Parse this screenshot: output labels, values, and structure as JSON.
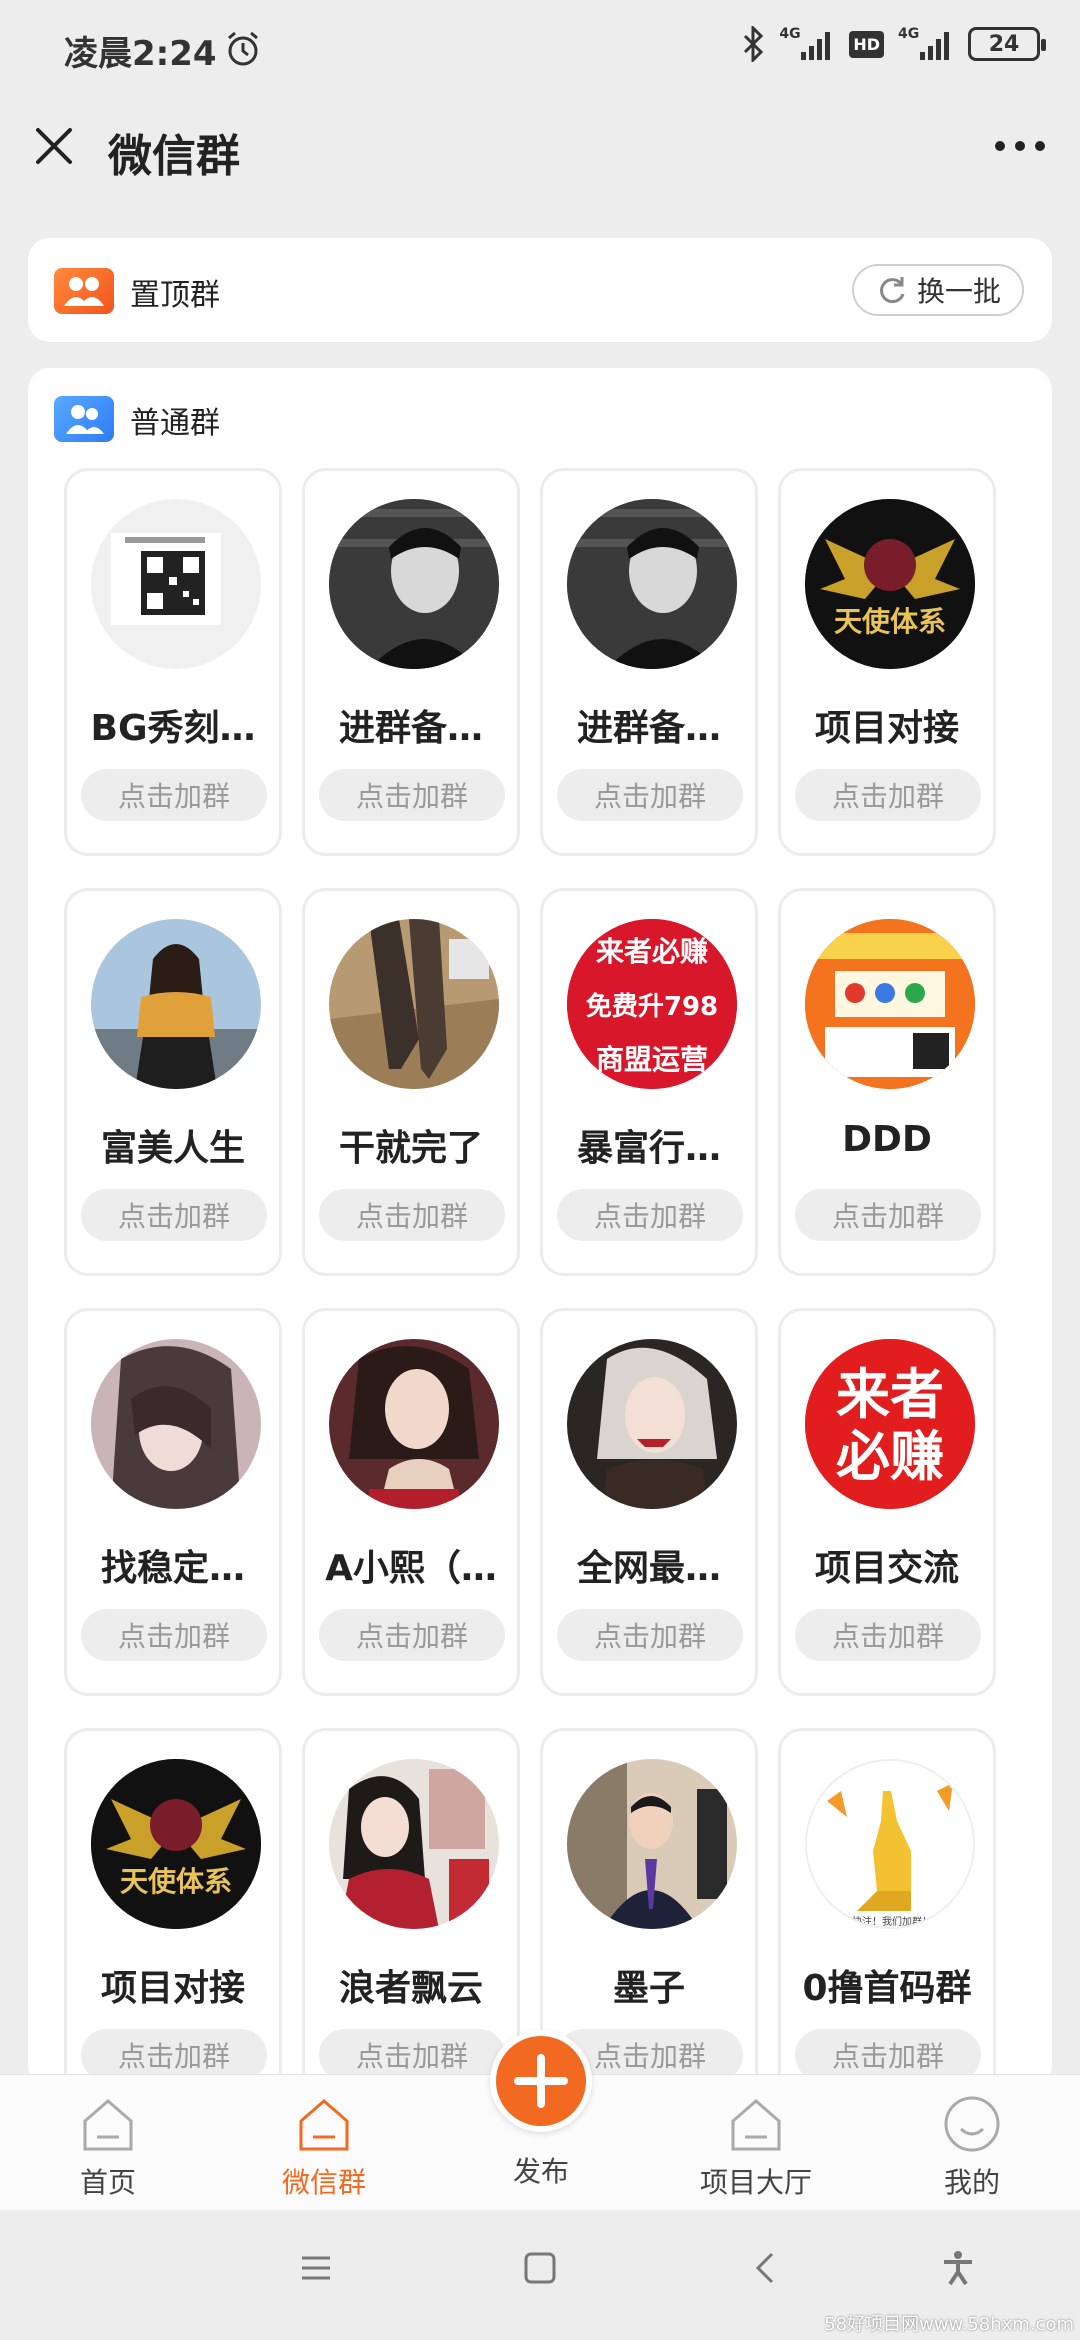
{
  "status_bar": {
    "time": "凌晨2:24",
    "battery": "24",
    "network_a": "4G",
    "network_b": "4G",
    "hd": "HD"
  },
  "header": {
    "title": "微信群"
  },
  "pinned": {
    "label": "置顶群",
    "refresh_label": "换一批"
  },
  "normal": {
    "label": "普通群"
  },
  "groups": [
    {
      "name": "BG秀刻…",
      "button": "点击加群",
      "avatar": "qr-code"
    },
    {
      "name": "进群备…",
      "button": "点击加群",
      "avatar": "bw-portrait"
    },
    {
      "name": "进群备…",
      "button": "点击加群",
      "avatar": "bw-portrait"
    },
    {
      "name": "项目对接",
      "button": "点击加群",
      "avatar": "angel-logo"
    },
    {
      "name": "富美人生",
      "button": "点击加群",
      "avatar": "woman-photo"
    },
    {
      "name": "干就完了",
      "button": "点击加群",
      "avatar": "legs-photo"
    },
    {
      "name": "暴富行…",
      "button": "点击加群",
      "avatar": "red-text-logo"
    },
    {
      "name": "DDD",
      "button": "点击加群",
      "avatar": "orange-poster"
    },
    {
      "name": "找稳定…",
      "button": "点击加群",
      "avatar": "woman-photo"
    },
    {
      "name": "A小熙（…",
      "button": "点击加群",
      "avatar": "woman-photo"
    },
    {
      "name": "全网最…",
      "button": "点击加群",
      "avatar": "woman-photo"
    },
    {
      "name": "项目交流",
      "button": "点击加群",
      "avatar": "red-text-logo"
    },
    {
      "name": "项目对接",
      "button": "点击加群",
      "avatar": "angel-logo"
    },
    {
      "name": "浪者飘云",
      "button": "点击加群",
      "avatar": "woman-photo"
    },
    {
      "name": "墨子",
      "button": "点击加群",
      "avatar": "man-suit"
    },
    {
      "name": "0撸首码群",
      "button": "点击加群",
      "avatar": "kangaroo"
    }
  ],
  "avatar_text": {
    "red_logo_1": "来者必赚",
    "red_logo_1_b": "免费升798",
    "red_logo_1_c": "商盟运营",
    "red_logo_2": "来者",
    "red_logo_2_b": "必赚",
    "angel": "天使体系",
    "kangaroo_caption": "快注！我们加群！"
  },
  "bottom_nav": {
    "home": "首页",
    "wechat_group": "微信群",
    "publish": "发布",
    "project_hall": "项目大厅",
    "mine": "我的"
  },
  "watermark": "58好项目网www.58hxm.com",
  "colors": {
    "accent": "#f26a22",
    "pinned_icon": "#f1541e",
    "normal_icon": "#2e7cf6",
    "button_bg": "#ededed"
  }
}
